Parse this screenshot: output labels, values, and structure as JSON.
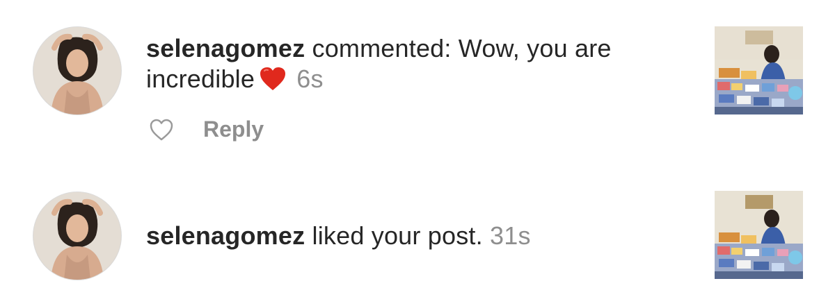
{
  "notifications": [
    {
      "avatar_icon": "profile-photo",
      "username": "selenagomez",
      "action_line1": " commented: Wow, you are",
      "action_line2": "incredible",
      "emoji": "red-heart-emoji",
      "time": "6s",
      "like_icon": "heart-outline-icon",
      "reply_label": "Reply",
      "thumbnail_icon": "post-thumbnail"
    },
    {
      "avatar_icon": "profile-photo",
      "username": "selenagomez",
      "action": " liked your post.",
      "time": "31s",
      "thumbnail_icon": "post-thumbnail"
    }
  ],
  "colors": {
    "text": "#262626",
    "muted": "#8e8e8e",
    "heart": "#e0291d"
  }
}
